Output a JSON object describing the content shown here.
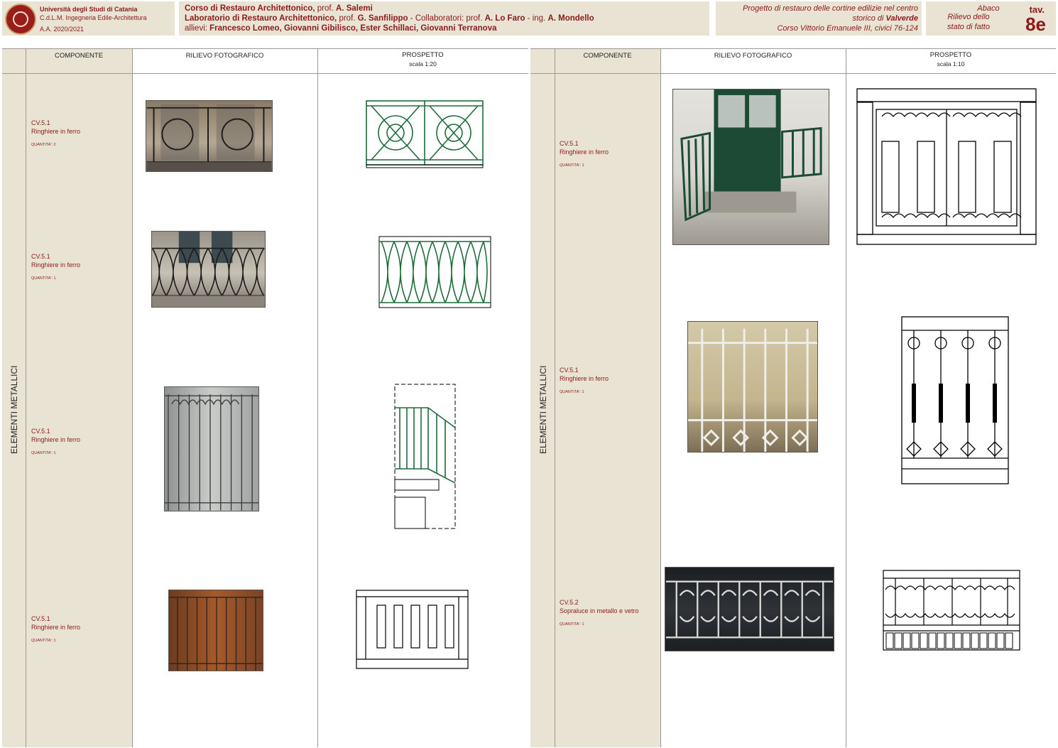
{
  "header": {
    "university": {
      "line1": "Università degli Studi di Catania",
      "line2": "C.d.L.M. Ingegneria Edile-Architettura",
      "line3": "A.A. 2020/2021"
    },
    "course": {
      "line1_a": "Corso di Restauro Architettonico,",
      "line1_b": " prof. ",
      "line1_c": "A. Salemi",
      "line2_a": "Laboratorio di Restauro Architettonico,",
      "line2_b": " prof. ",
      "line2_c": "G. Sanfilippo",
      "line2_d": " - Collaboratori: prof. ",
      "line2_e": "A. Lo Faro",
      "line2_f": " - ing. ",
      "line2_g": "A. Mondello",
      "line3_a": "allievi:  ",
      "line3_b": "Francesco Lomeo, Giovanni Gibilisco, Ester Schillaci, Giovanni Terranova"
    },
    "project": {
      "line1": "Progetto di restauro delle cortine edilizie nel centro",
      "line2_a": "storico di ",
      "line2_b": "Valverde",
      "line3": "Corso Vittorio Emanuele III, civici 76-124"
    },
    "board": {
      "abaco1": "Abaco",
      "abaco2": "Rilievo dello",
      "abaco3": "stato di fatto",
      "tav_label": "tav.",
      "tav_number": "8e"
    }
  },
  "table": {
    "columns": {
      "component": "COMPONENTE",
      "photo": "RILIEVO FOTOGRAFICO",
      "elevation": "PROSPETTO",
      "scale_left": "scala 1:20",
      "scale_right": "scala 1:10"
    },
    "category": "ELEMENTI METALLICI",
    "left_rows": [
      {
        "code": "CV.5.1",
        "name": "Ringhiere in ferro",
        "qty": "QUANTITA': 2"
      },
      {
        "code": "CV.5.1",
        "name": "Ringhiere in ferro",
        "qty": "QUANTITA': 1"
      },
      {
        "code": "CV.5.1",
        "name": "Ringhiere in ferro",
        "qty": "QUANTITA': 1"
      },
      {
        "code": "CV.5.1",
        "name": "Ringhiere in ferro",
        "qty": "QUANTITA': 1"
      }
    ],
    "right_rows": [
      {
        "code": "CV.5.1",
        "name": "Ringhiere in ferro",
        "qty": "QUANTITA': 1"
      },
      {
        "code": "CV.5.1",
        "name": "Ringhiere in ferro",
        "qty": "QUANTITA': 1"
      },
      {
        "code": "CV.5.2",
        "name": "Sopraluce in metallo e vetro",
        "qty": "QUANTITA': 1"
      }
    ]
  }
}
